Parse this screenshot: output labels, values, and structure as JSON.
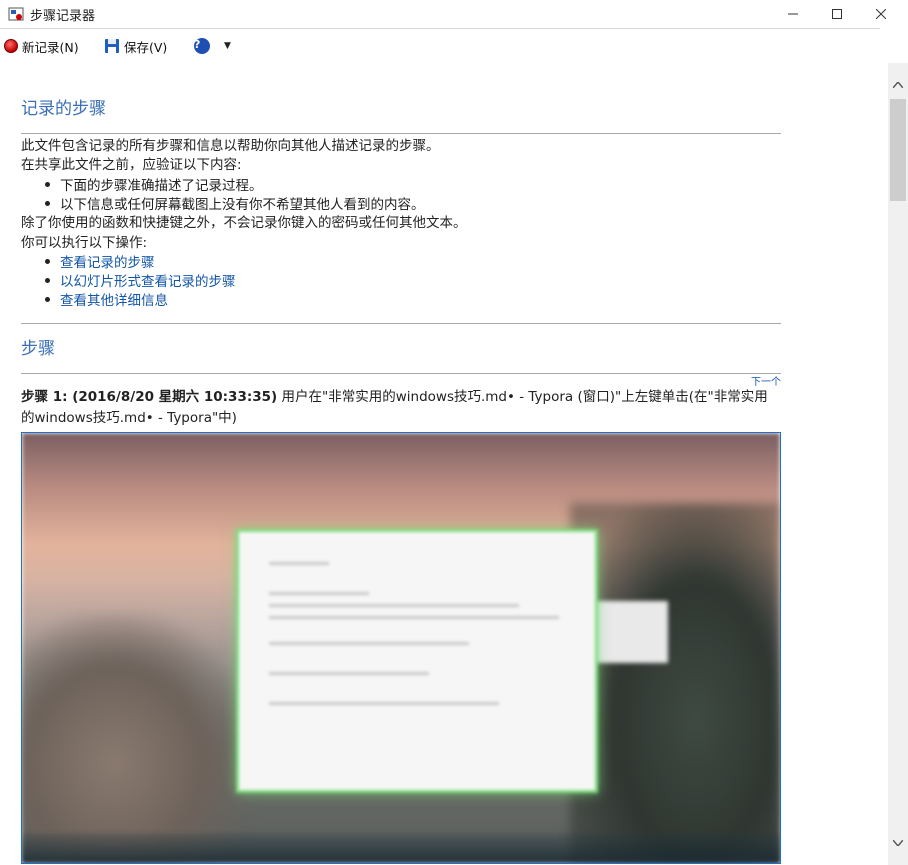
{
  "window": {
    "title": "步骤记录器"
  },
  "toolbar": {
    "new_label": "新记录(N)",
    "save_label": "保存(V)",
    "help_symbol": "?"
  },
  "doc": {
    "title": "记录的步骤",
    "intro": "此文件包含记录的所有步骤和信息以帮助你向其他人描述记录的步骤。",
    "verify": "在共享此文件之前，应验证以下内容:",
    "checks": [
      "下面的步骤准确描述了记录过程。",
      "以下信息或任何屏幕截图上没有你不希望其他人看到的内容。"
    ],
    "note": "除了你使用的函数和快捷键之外，不会记录你键入的密码或任何其他文本。",
    "can_do": "你可以执行以下操作:",
    "links": [
      "查看记录的步骤",
      "以幻灯片形式查看记录的步骤",
      "查看其他详细信息"
    ],
    "steps_title": "步骤",
    "next_label": "下一个",
    "step1": {
      "label": "步骤 1: (2016/8/20 星期六 10:33:35)",
      "text": " 用户在\"非常实用的windows技巧.md• - Typora (窗口)\"上左键单击(在\"非常实用的windows技巧.md• - Typora\"中)"
    }
  },
  "colors": {
    "heading": "#3a6fb7",
    "link": "#1155a8",
    "highlight_border": "#7fdc7f",
    "screenshot_border": "#1d6fd1"
  },
  "icons": {
    "record": "record-icon",
    "save": "save-icon",
    "help": "help-icon",
    "minimize": "minimize-icon",
    "maximize": "maximize-icon",
    "close": "close-icon"
  }
}
